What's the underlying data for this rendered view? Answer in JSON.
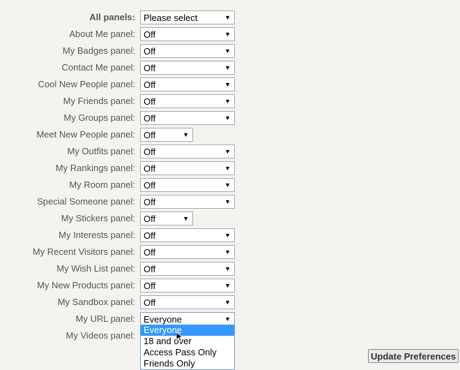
{
  "form": {
    "rows": [
      {
        "label": "All panels:",
        "value": "Please select",
        "bold": true
      },
      {
        "label": "About Me panel:",
        "value": "Off"
      },
      {
        "label": "My Badges panel:",
        "value": "Off"
      },
      {
        "label": "Contact Me panel:",
        "value": "Off"
      },
      {
        "label": "Cool New People panel:",
        "value": "Off"
      },
      {
        "label": "My Friends panel:",
        "value": "Off"
      },
      {
        "label": "My Groups panel:",
        "value": "Off"
      },
      {
        "label": "Meet New People panel:",
        "value": "Off"
      },
      {
        "label": "My Outfits panel:",
        "value": "Off"
      },
      {
        "label": "My Rankings panel:",
        "value": "Off"
      },
      {
        "label": "My Room panel:",
        "value": "Off"
      },
      {
        "label": "Special Someone panel:",
        "value": "Off"
      },
      {
        "label": "My Stickers panel:",
        "value": "Off"
      },
      {
        "label": "My Interests panel:",
        "value": "Off"
      },
      {
        "label": "My Recent Visitors panel:",
        "value": "Off"
      },
      {
        "label": "My Wish List panel:",
        "value": "Off"
      },
      {
        "label": "My New Products panel:",
        "value": "Off"
      },
      {
        "label": "My Sandbox panel:",
        "value": "Off"
      },
      {
        "label": "My URL panel:",
        "value": "Everyone"
      },
      {
        "label": "My Videos panel:",
        "value": ""
      }
    ],
    "open_dropdown_options": [
      "Everyone",
      "18 and over",
      "Access Pass Only",
      "Friends Only"
    ],
    "highlighted_option": "Everyone",
    "arrow_glyph": "▼",
    "submit_label": "Update Preferences"
  }
}
